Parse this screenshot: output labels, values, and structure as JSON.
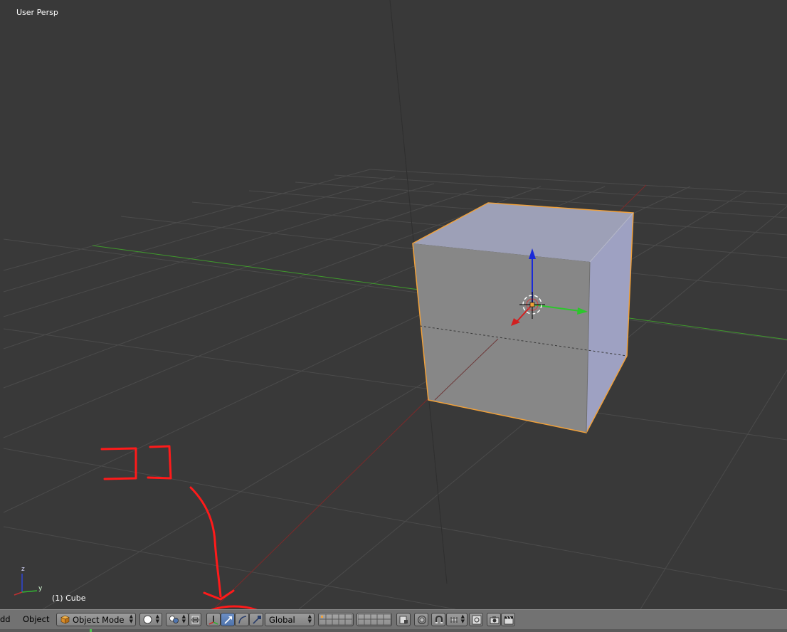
{
  "viewport": {
    "view_label": "User Persp",
    "object_label": "(1) Cube",
    "axis_labels": {
      "z": "z",
      "y": "y"
    }
  },
  "header": {
    "menu_add": "dd",
    "menu_object": "Object",
    "mode": "Object Mode",
    "orientation": "Global"
  },
  "annotation": {
    "scribble": "コ1",
    "color": "#ff1a1a"
  },
  "colors": {
    "background": "#393939",
    "grid": "#4d4d4d",
    "x_axis": "#a12b2b",
    "y_axis": "#3f9a2c",
    "selection": "#f1a13a",
    "cube_top": "#9da0b7",
    "cube_front": "#878787",
    "cube_side": "#9ea1c2"
  }
}
